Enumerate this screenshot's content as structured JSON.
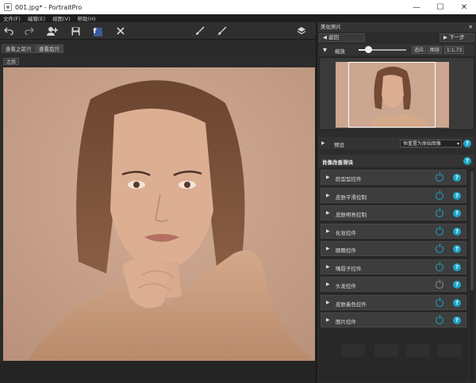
{
  "window": {
    "title": "001.jpg* - PortraitPro",
    "minimize": "—",
    "maximize": "☐",
    "close": "✕"
  },
  "menu": [
    "文件(F)",
    "编辑(E)",
    "视图(V)",
    "帮助(H)"
  ],
  "view_tabs": [
    "查看之前只",
    "查看后只"
  ],
  "after_label": "之后",
  "right_panel": {
    "title": "美化照片",
    "close": "✕",
    "back_label": "◀ 返回",
    "next_label": "▶ 下一步",
    "zoom_label": "缩放",
    "zoom_slider_value": 0.2,
    "fit_label": "适应",
    "size_label": "图容",
    "ratio_label": "1:1.73",
    "preset_label": "预设",
    "preset_value": "恒重置为原始图像",
    "section_title": "肖像改善滑块",
    "controls": [
      {
        "label": "脸型型控件",
        "enabled": true
      },
      {
        "label": "皮肤平滑控制",
        "enabled": true
      },
      {
        "label": "皮肤明亮控制",
        "enabled": true
      },
      {
        "label": "化妆控件",
        "enabled": true
      },
      {
        "label": "眼睛控件",
        "enabled": true
      },
      {
        "label": "嘴唇子控件",
        "enabled": true
      },
      {
        "label": "头发控件",
        "enabled": false
      },
      {
        "label": "皮肤着色控件",
        "enabled": true
      },
      {
        "label": "图片控件",
        "enabled": true
      }
    ]
  },
  "icons": {
    "app": "app-icon",
    "undo": "undo-icon",
    "redo": "redo-icon",
    "add_person": "add-person-icon",
    "save": "save-icon",
    "facebook": "facebook-icon",
    "close": "close-icon",
    "brush": "brush-icon",
    "brush2": "brush-erase-icon",
    "layers": "layers-icon",
    "power": "power-icon",
    "help": "help-icon"
  },
  "colors": {
    "accent": "#1da6c9",
    "facebook": "#3b5998"
  }
}
